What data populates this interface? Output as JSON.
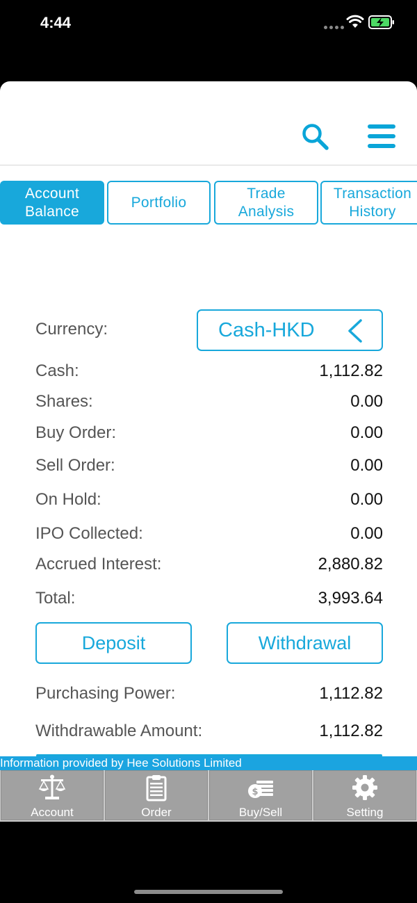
{
  "status_bar": {
    "time": "4:44"
  },
  "tabs": [
    {
      "label": "Account\nBalance",
      "active": true
    },
    {
      "label": "Portfolio",
      "active": false
    },
    {
      "label": "Trade\nAnalysis",
      "active": false
    },
    {
      "label": "Transaction\nHistory",
      "active": false
    }
  ],
  "balance": {
    "currency_label": "Currency:",
    "currency_value": "Cash-HKD",
    "rows": [
      {
        "label": "Cash:",
        "value": "1,112.82"
      },
      {
        "label": "Shares:",
        "value": "0.00"
      },
      {
        "label": "Buy Order:",
        "value": "0.00"
      },
      {
        "label": "Sell Order:",
        "value": "0.00"
      },
      {
        "label": "On Hold:",
        "value": "0.00"
      },
      {
        "label": "IPO Collected:",
        "value": "0.00"
      },
      {
        "label": "Accrued Interest:",
        "value": "2,880.82"
      },
      {
        "label": "Total:",
        "value": "3,993.64"
      }
    ],
    "deposit_label": "Deposit",
    "withdrawal_label": "Withdrawal",
    "purchasing_power_label": "Purchasing Power:",
    "purchasing_power_value": "1,112.82",
    "withdrawable_label": "Withdrawable Amount:",
    "withdrawable_value": "1,112.82"
  },
  "info_bar": {
    "text": "Information provided by Hee Solutions Limited"
  },
  "tabbar": [
    {
      "label": "Account",
      "icon": "scale-icon"
    },
    {
      "label": "Order",
      "icon": "clipboard-icon"
    },
    {
      "label": "Buy/Sell",
      "icon": "money-icon"
    },
    {
      "label": "Setting",
      "icon": "gear-icon"
    }
  ],
  "colors": {
    "accent": "#18a8db",
    "info_bar": "#1ba4e0",
    "tabbar_bg": "#a1a1a1"
  }
}
